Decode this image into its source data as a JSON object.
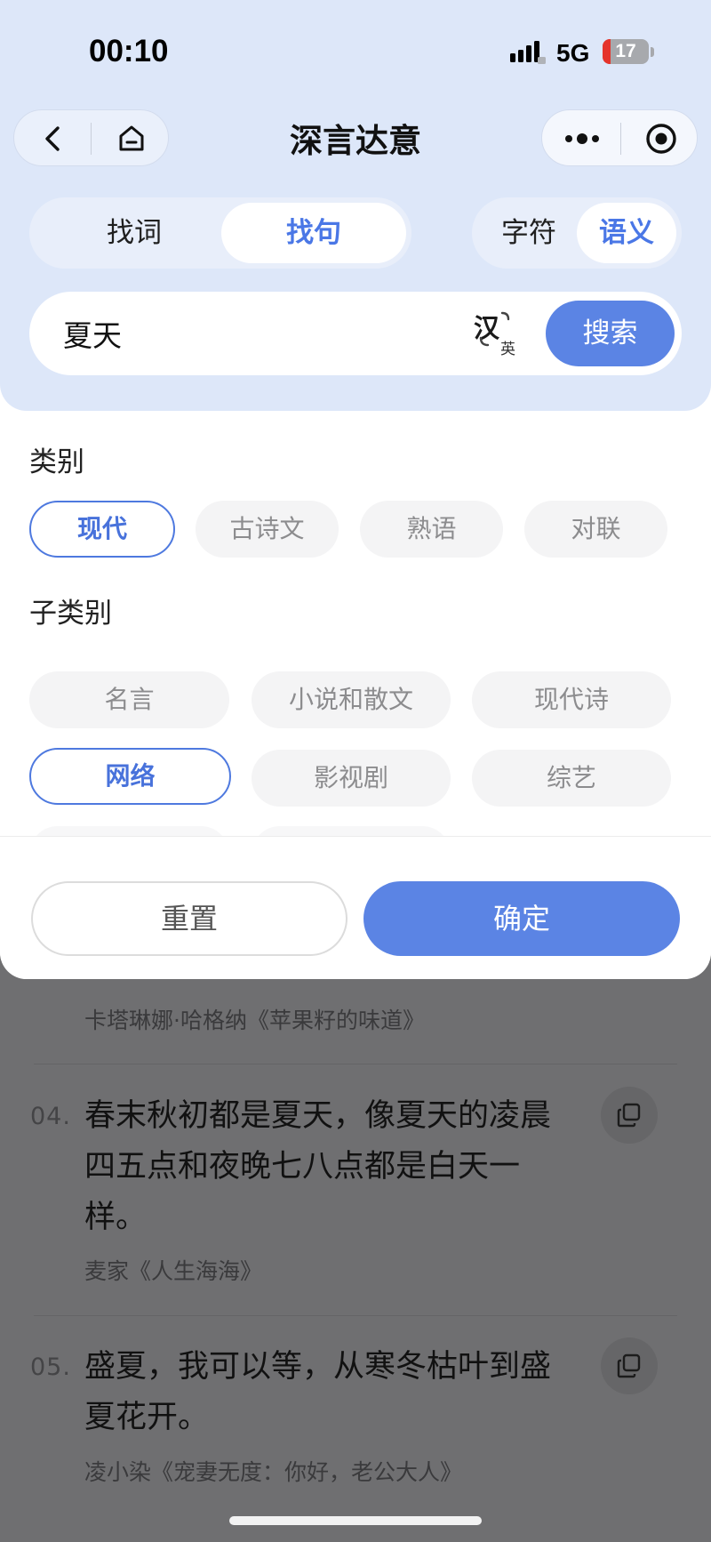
{
  "status_bar": {
    "time": "00:10",
    "network": "5G",
    "battery_level": "17"
  },
  "nav": {
    "title": "深言达意"
  },
  "mode_tabs": {
    "options": [
      "找词",
      "找句"
    ],
    "selected": "找句"
  },
  "match_tabs": {
    "options": [
      "字符",
      "语义"
    ],
    "selected": "语义"
  },
  "search": {
    "query": "夏天",
    "lang_primary": "汉",
    "lang_secondary": "英",
    "button_label": "搜索"
  },
  "filters": {
    "category_label": "类别",
    "categories": [
      "现代",
      "古诗文",
      "熟语",
      "对联"
    ],
    "category_selected": "现代",
    "subcategory_label": "子类别",
    "subcategories": [
      "名言",
      "小说和散文",
      "现代诗",
      "网络",
      "影视剧",
      "综艺"
    ],
    "subcategory_selected": "网络"
  },
  "actions": {
    "reset_label": "重置",
    "confirm_label": "确定"
  },
  "results": {
    "partial_author": "卡塔琳娜·哈格纳《苹果籽的味道》",
    "items": [
      {
        "number": "04.",
        "lines": [
          "春末秋初都是夏天，像夏天的凌晨",
          "四五点和夜晚七八点都是白天一",
          "样。"
        ],
        "author": "麦家《人生海海》"
      },
      {
        "number": "05.",
        "lines": [
          "盛夏，我可以等，从寒冬枯叶到盛",
          "夏花开。"
        ],
        "author": "凌小染《宠妻无度：你好，老公大人》"
      }
    ]
  }
}
